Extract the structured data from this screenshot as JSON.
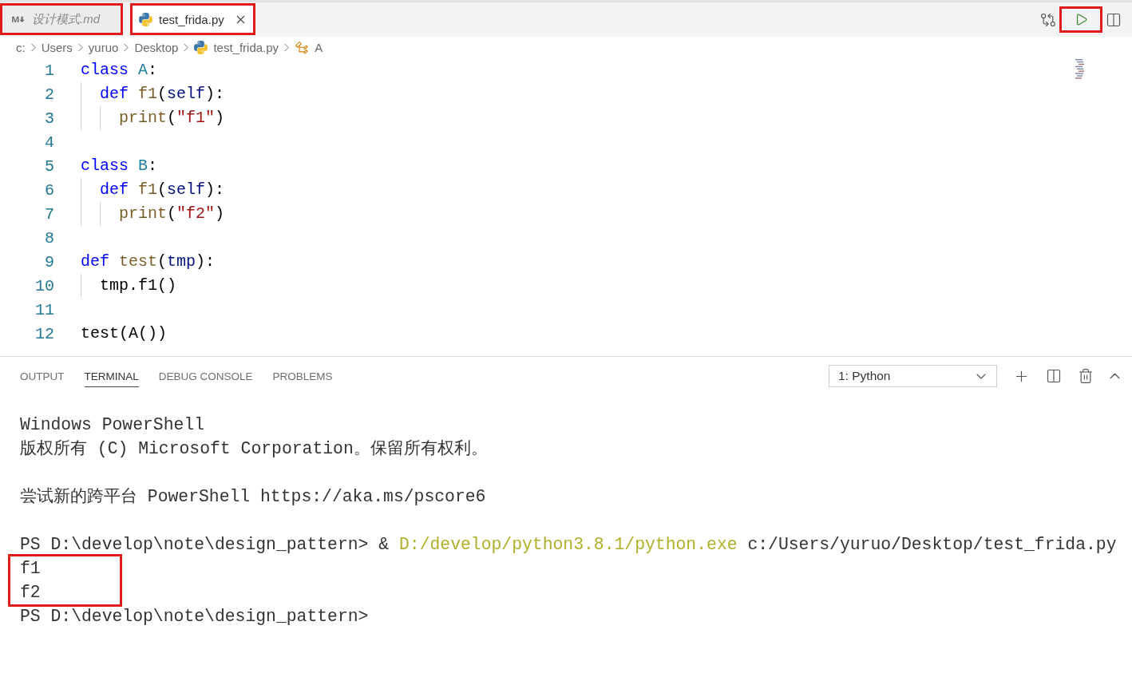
{
  "tabs": [
    {
      "label": "设计模式.md",
      "kind": "markdown",
      "selected": false,
      "preview": true,
      "highlighted": true
    },
    {
      "label": "test_frida.py",
      "kind": "python",
      "selected": true,
      "preview": false,
      "highlighted": true
    }
  ],
  "run_button": {
    "highlighted": true
  },
  "breadcrumb": [
    {
      "label": "c:",
      "kind": "folder"
    },
    {
      "label": "Users",
      "kind": "folder"
    },
    {
      "label": "yuruo",
      "kind": "folder"
    },
    {
      "label": "Desktop",
      "kind": "folder"
    },
    {
      "label": "test_frida.py",
      "kind": "python"
    },
    {
      "label": "A",
      "kind": "class"
    }
  ],
  "code_lines": [
    {
      "number": "1",
      "tokens": [
        {
          "text": "class ",
          "kind": "keyword"
        },
        {
          "text": "A",
          "kind": "class_name"
        },
        {
          "text": ":",
          "kind": "plain"
        }
      ],
      "children": [
        {
          "number": "2",
          "tokens": [
            {
              "text": "def ",
              "kind": "keyword"
            },
            {
              "text": "f1",
              "kind": "function"
            },
            {
              "text": "(",
              "kind": "plain"
            },
            {
              "text": "self",
              "kind": "parameter"
            },
            {
              "text": "):",
              "kind": "plain"
            }
          ],
          "children": [
            {
              "number": "3",
              "tokens": [
                {
                  "text": "print",
                  "kind": "function"
                },
                {
                  "text": "(",
                  "kind": "plain"
                },
                {
                  "text": "\"f1\"",
                  "kind": "string"
                },
                {
                  "text": ")",
                  "kind": "plain"
                }
              ]
            }
          ]
        }
      ]
    },
    {
      "number": "4"
    },
    {
      "number": "5",
      "tokens": [
        {
          "text": "class ",
          "kind": "keyword"
        },
        {
          "text": "B",
          "kind": "class_name"
        },
        {
          "text": ":",
          "kind": "plain"
        }
      ],
      "children": [
        {
          "number": "6",
          "tokens": [
            {
              "text": "def ",
              "kind": "keyword"
            },
            {
              "text": "f1",
              "kind": "function"
            },
            {
              "text": "(",
              "kind": "plain"
            },
            {
              "text": "self",
              "kind": "parameter"
            },
            {
              "text": "):",
              "kind": "plain"
            }
          ],
          "children": [
            {
              "number": "7",
              "tokens": [
                {
                  "text": "print",
                  "kind": "function"
                },
                {
                  "text": "(",
                  "kind": "plain"
                },
                {
                  "text": "\"f2\"",
                  "kind": "string"
                },
                {
                  "text": ")",
                  "kind": "plain"
                }
              ]
            }
          ]
        }
      ]
    },
    {
      "number": "8"
    },
    {
      "number": "9",
      "tokens": [
        {
          "text": "def ",
          "kind": "keyword"
        },
        {
          "text": "test",
          "kind": "function"
        },
        {
          "text": "(",
          "kind": "plain"
        },
        {
          "text": "tmp",
          "kind": "parameter"
        },
        {
          "text": "):",
          "kind": "plain"
        }
      ],
      "children": [
        {
          "number": "10",
          "tokens": [
            {
              "text": "tmp.f1()",
              "kind": "plain"
            }
          ]
        }
      ]
    },
    {
      "number": "11"
    },
    {
      "number": "12",
      "tokens": [
        {
          "text": "test(A())",
          "kind": "plain"
        }
      ]
    }
  ],
  "panel": {
    "tabs": [
      {
        "label": "OUTPUT",
        "selected": false
      },
      {
        "label": "TERMINAL",
        "selected": true
      },
      {
        "label": "DEBUG CONSOLE",
        "selected": false
      },
      {
        "label": "PROBLEMS",
        "selected": false
      }
    ],
    "terminal_select": {
      "value": "1: Python"
    },
    "terminal": {
      "blocks": [
        {
          "lines": [
            {
              "text": "Windows PowerShell",
              "highlighted": false
            },
            {
              "text": "版权所有 (C) Microsoft Corporation。保留所有权利。",
              "highlighted": false
            }
          ]
        },
        {
          "lines": [
            {
              "text": "尝试新的跨平台 PowerShell https://aka.ms/pscore6",
              "highlighted": false
            }
          ]
        },
        {
          "lines": [
            {
              "segments": [
                {
                  "text": "PS D:\\develop\\note\\design_pattern> & ",
                  "kind": "plain"
                },
                {
                  "text": "D:/develop/python3.8.1/python.exe",
                  "kind": "path"
                },
                {
                  "text": " c:/Users/yuruo/Desktop/test_frida.py",
                  "kind": "plain"
                }
              ],
              "highlighted": false
            },
            {
              "text": "f1",
              "highlighted": true
            },
            {
              "text": "f2",
              "highlighted": true
            },
            {
              "text": "PS D:\\develop\\note\\design_pattern>",
              "highlighted": false
            }
          ]
        }
      ]
    }
  }
}
